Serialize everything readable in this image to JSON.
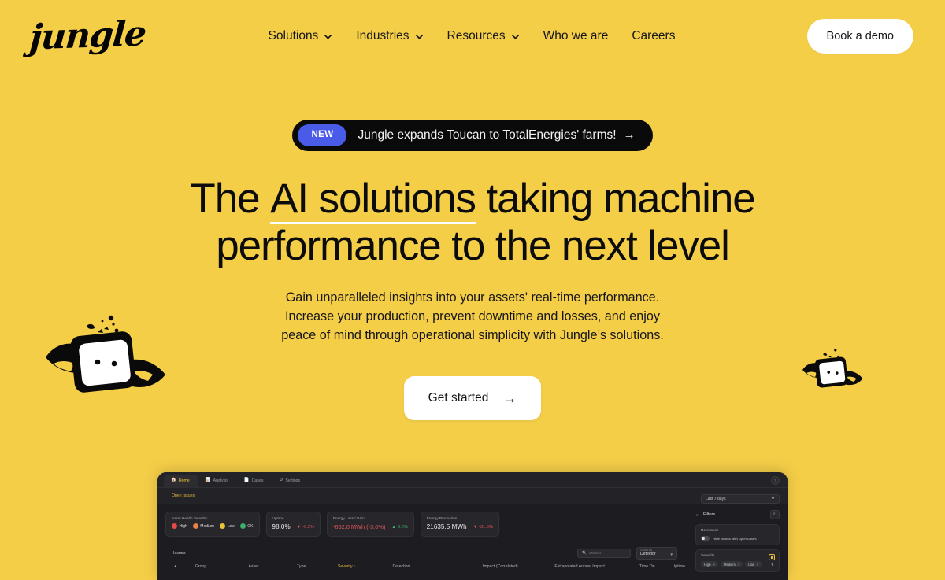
{
  "brand": {
    "name": "jungle"
  },
  "nav": {
    "items": [
      {
        "label": "Solutions",
        "has_dropdown": true
      },
      {
        "label": "Industries",
        "has_dropdown": true
      },
      {
        "label": "Resources",
        "has_dropdown": true
      },
      {
        "label": "Who we are",
        "has_dropdown": false
      },
      {
        "label": "Careers",
        "has_dropdown": false
      }
    ],
    "cta_label": "Book a demo"
  },
  "announcement": {
    "badge": "NEW",
    "text": "Jungle expands Toucan to TotalEnergies' farms!",
    "arrow": "→"
  },
  "hero": {
    "headline_part1": "The ",
    "headline_underlined": "AI solutions",
    "headline_part2": " taking machine",
    "headline_line2": "performance to the next level",
    "sub_line1": "Gain unparalleled insights into your assets' real-time performance.",
    "sub_line2": "Increase your production, prevent downtime and losses, and enjoy",
    "sub_line3": "peace of mind through operational simplicity with Jungle’s solutions.",
    "cta_label": "Get started",
    "cta_arrow": "→"
  },
  "colors": {
    "background": "#F5CE48",
    "badge_blue": "#4A5BE8",
    "banner_black": "#0A0A0A",
    "accent_yellow": "#E6BB3C",
    "dashboard_bg": "#1D1D21",
    "severity_high": "#E04A4A",
    "severity_medium": "#E8804A",
    "severity_low": "#E8C33C",
    "severity_ok": "#3FAE6D",
    "positive": "#3FAE6D",
    "negative": "#E45757"
  },
  "dashboard": {
    "tabs": [
      {
        "label": "Home",
        "icon": "home-icon",
        "active": true
      },
      {
        "label": "Analysis",
        "icon": "chart-icon",
        "active": false
      },
      {
        "label": "Cases",
        "icon": "document-icon",
        "active": false
      },
      {
        "label": "Settings",
        "icon": "gear-icon",
        "active": false
      }
    ],
    "subtab": "Open Issues",
    "date_range": "Last 7 days",
    "kpis": [
      {
        "title": "Asset Health Severity",
        "type": "legend",
        "legend": [
          {
            "label": "High",
            "color": "#E04A4A"
          },
          {
            "label": "Medium",
            "color": "#E8804A"
          },
          {
            "label": "Low",
            "color": "#E8C33C"
          },
          {
            "label": "OK",
            "color": "#3FAE6D"
          }
        ]
      },
      {
        "title": "Uptime",
        "value": "98.0%",
        "delta": "-0.2%",
        "direction": "down"
      },
      {
        "title": "Energy Loss / Gain",
        "value": "-662.0 MWh (-3.0%)",
        "delta": "9.6%",
        "direction": "up",
        "value_negative": true
      },
      {
        "title": "Energy Production",
        "value": "21635.5 MWh",
        "delta": "-31.5%",
        "direction": "down"
      }
    ],
    "issues_label": "Issues",
    "search_placeholder": "Search",
    "group_by_label": "Group By",
    "group_by_value": "Detector",
    "table_columns": [
      "Group",
      "Asset",
      "Type",
      "Severity",
      "Detection",
      "Impact (Correlated)",
      "Extrapolated Annual Impact",
      "Time On",
      "Uptime"
    ],
    "sorted_column": "Severity",
    "filters": {
      "title": "Filters",
      "reset_icon": "reset-icon",
      "sections": [
        {
          "title": "Relevance",
          "toggle_label": "Hide assets with open cases",
          "toggle_on": false
        },
        {
          "title": "Severity",
          "chips": [
            "High",
            "Medium",
            "Low"
          ]
        }
      ]
    }
  }
}
